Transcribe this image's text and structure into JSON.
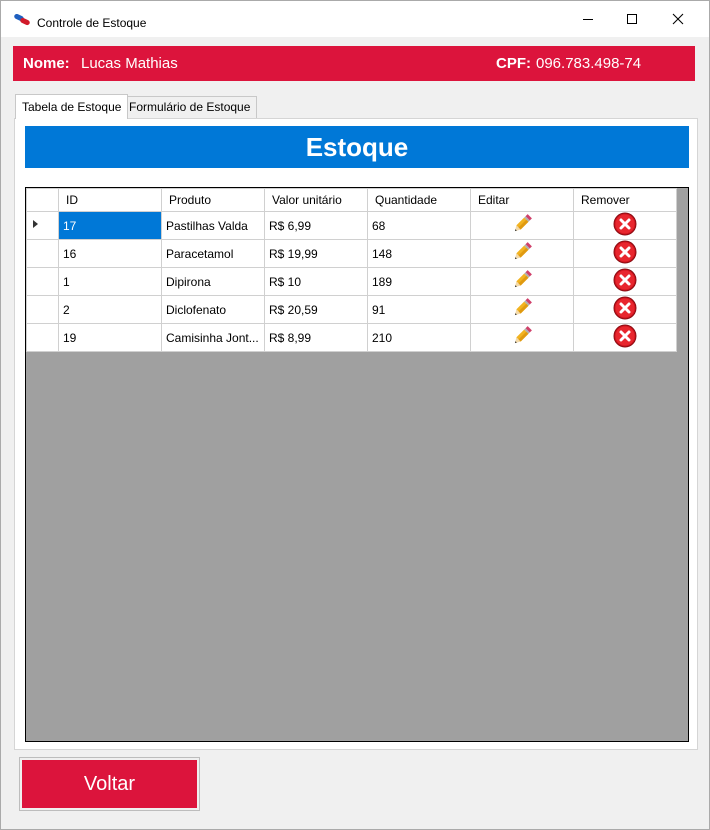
{
  "window": {
    "title": "Controle de Estoque",
    "app_icon": "pills-icon",
    "controls": [
      "minimize-icon",
      "maximize-icon",
      "close-icon"
    ]
  },
  "header": {
    "name_label": "Nome:",
    "name_value": "Lucas Mathias",
    "cpf_label": "CPF:",
    "cpf_value": "096.783.498-74",
    "color": "#dc143c"
  },
  "tabs": [
    {
      "label": "Tabela de Estoque",
      "active": true
    },
    {
      "label": "Formulário de Estoque",
      "active": false
    }
  ],
  "banner": {
    "title": "Estoque",
    "color": "#0078d7"
  },
  "table": {
    "columns": [
      "ID",
      "Produto",
      "Valor unitário",
      "Quantidade",
      "Editar",
      "Remover"
    ],
    "rows": [
      {
        "id": "17",
        "produto": "Pastilhas Valda",
        "valor": "R$ 6,99",
        "quantidade": "68",
        "selected": true
      },
      {
        "id": "16",
        "produto": "Paracetamol",
        "valor": "R$ 19,99",
        "quantidade": "148",
        "selected": false
      },
      {
        "id": "1",
        "produto": "Dipirona",
        "valor": "R$ 10",
        "quantidade": "189",
        "selected": false
      },
      {
        "id": "2",
        "produto": "Diclofenato",
        "valor": "R$ 20,59",
        "quantidade": "91",
        "selected": false
      },
      {
        "id": "19",
        "produto": "Camisinha Jont...",
        "valor": "R$ 8,99",
        "quantidade": "210",
        "selected": false
      }
    ],
    "edit_icon": "pencil-icon",
    "remove_icon": "remove-x-icon"
  },
  "footer": {
    "back_label": "Voltar"
  }
}
